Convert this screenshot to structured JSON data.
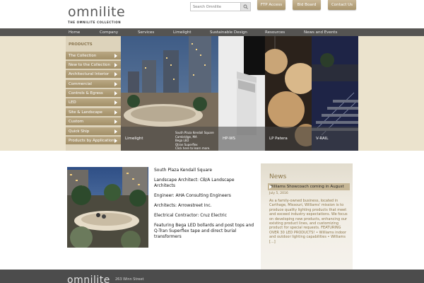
{
  "brand": {
    "logo_text": "omnilite",
    "tagline": "THE OMNILITE COLLECTION"
  },
  "search": {
    "placeholder": "Search Omnilite"
  },
  "top_buttons": [
    "FTP Access",
    "Bid Board",
    "Contact Us"
  ],
  "nav": [
    "Home",
    "Company",
    "Services",
    "Limelight",
    "Sustainable Design",
    "Resources",
    "News and Events"
  ],
  "sidebar": {
    "heading": "PRODUCTS",
    "items": [
      "The Collection",
      "New to the Collection",
      "Architectural Interior",
      "Commercial",
      "Controls & Egress",
      "LED",
      "Site & Landscape",
      "Custom",
      "Quick Ship",
      "Products by Application"
    ]
  },
  "showcase": {
    "panels": [
      "Limelight",
      "HP-WS",
      "LP Patera",
      "V-RAIL"
    ],
    "detail_lines": [
      "South Plaza Kendall Square",
      "Cambridge, MA",
      "Bega LED",
      "Qtran Superflex",
      "Click here to learn more."
    ]
  },
  "project": {
    "lines": [
      "South Plaza Kendall Square",
      "Landscape Architect: CB/A Landscape Architects",
      "Engineer: AHA Consulting Engineers",
      "Architects: Arrowstreet Inc.",
      "Electrical Contractor: Cruz Electric",
      "Featuring Bega LED bollards and post tops and Q-Tran Superflex tape and direct burial transformers"
    ]
  },
  "news": {
    "heading": "News",
    "title": "Williams Showcoach coming in August",
    "date": "July 5, 2016",
    "body": "As a family-owned business, located in Carthage, Missouri, Williams' mission is to produce quality lighting products that meet and exceed industry expectations. We focus on developing new products, enhancing our existing product lines, and customizing product for special requests. FEATURING OVER 30 LED PRODUCTS! • Williams indoor and outdoor lighting capabilities • Williams [...]"
  },
  "footer": {
    "logo_text": "omnilite",
    "address": "263 Winn Street"
  },
  "colors": {
    "tan": "#ebe3cd",
    "sidebar_button": "#a99670",
    "nav_bar": "#555452",
    "accent_text": "#8c7649",
    "footer": "#4c4c4c"
  }
}
